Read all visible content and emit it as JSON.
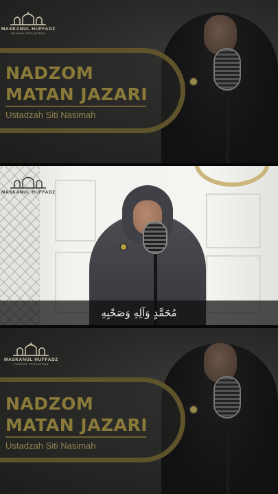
{
  "logo": {
    "arabic": "مسكن الحفاظ",
    "name": "MASKANUL HUFFADZ",
    "sub": "PONDOK PESANTREN"
  },
  "title": {
    "line1": "NADZOM",
    "line2": "MATAN JAZARI"
  },
  "subtitle": "Ustadzah Siti Nasimah",
  "caption": "مُحَمَّدٍ وَآلِهِ وَصَحْبِهِ",
  "colors": {
    "gold": "#8a7a3a",
    "dark": "#2a2a29",
    "caption_bg": "#0f0f0f"
  }
}
